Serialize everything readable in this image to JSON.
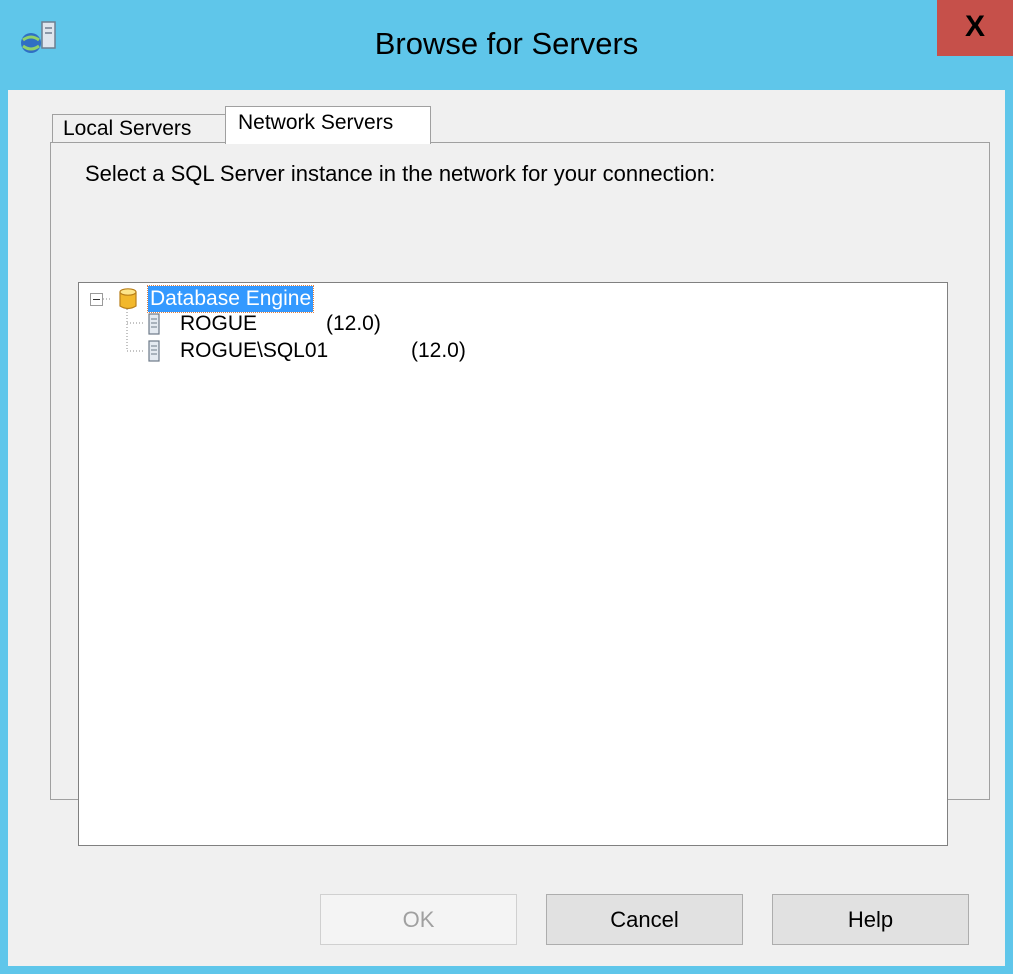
{
  "window": {
    "title": "Browse for Servers",
    "close_label": "X"
  },
  "tabs": [
    {
      "label": "Local Servers",
      "selected": false
    },
    {
      "label": "Network Servers",
      "selected": true
    }
  ],
  "panel": {
    "instruction": "Select a SQL Server instance in the network for your connection:"
  },
  "tree": {
    "root": {
      "label": "Database Engine",
      "icon": "database-cylinder-icon",
      "expanded": true,
      "selected": true
    },
    "children": [
      {
        "name": "ROGUE",
        "version": "(12.0)",
        "icon": "server-icon"
      },
      {
        "name": "ROGUE\\SQL01",
        "version": "(12.0)",
        "icon": "server-icon"
      }
    ]
  },
  "buttons": {
    "ok": {
      "label": "OK",
      "enabled": false
    },
    "cancel": {
      "label": "Cancel",
      "enabled": true
    },
    "help": {
      "label": "Help",
      "enabled": true
    }
  },
  "colors": {
    "title_bar": "#5fc6ea",
    "close_button": "#c6504a",
    "selection": "#3399ff"
  }
}
